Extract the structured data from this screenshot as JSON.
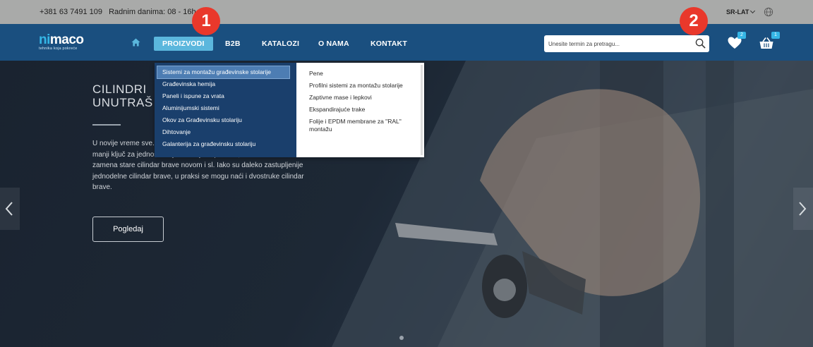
{
  "topbar": {
    "phone": "+381 63 7491 109",
    "hours": "Radnim danima: 08 - 16h",
    "language": "SR-LAT"
  },
  "logo": {
    "word_part1": "ni",
    "word_part2": "maco",
    "tagline": "tehnika koja pokreće"
  },
  "nav": {
    "items": [
      {
        "label": "PROIZVODI",
        "active": true
      },
      {
        "label": "B2B"
      },
      {
        "label": "KATALOZI"
      },
      {
        "label": "O NAMA"
      },
      {
        "label": "KONTAKT"
      }
    ]
  },
  "search": {
    "placeholder": "Unesite termin za pretragu..."
  },
  "wishlist": {
    "count": "2"
  },
  "cart": {
    "count": "1"
  },
  "dropdown": {
    "left_items": [
      "Sistemi za montažu građevinske stolarije",
      "Građevinska hemija",
      "Paneli i ispune za vrata",
      "Aluminijumski sistemi",
      "Okov za Građevinsku stolariju",
      "Dihtovanje",
      "Galanterija za građevinsku stolariju"
    ],
    "right_items": [
      "Pene",
      "Profilni sistemi za montažu stolarije",
      "Zaptivne mase i lepkovi",
      "Ekspandirajuće trake",
      "Folije i EPDM membrane za \"RAL\" montažu"
    ]
  },
  "hero": {
    "title_line1": "CILINDRI",
    "title_line2": "UNUTRAŠ",
    "description": "U novije vreme sve... praktičnije za upot... koji se ne može kopirati, manji ključ za jednostavnije nošenje i upotrebu, lakša demontaža i zamena stare cilindar brave novom i sl. Iako su daleko zastupljenije jednodelne cilindar brave, u praksi se mogu naći i dvostruke cilindar brave.",
    "cta_label": "Pogledaj"
  },
  "markers": {
    "one": "1",
    "two": "2"
  },
  "colors": {
    "navbar": "#1a4f7f",
    "accent": "#35b6e6",
    "active_nav": "#5bb7dd",
    "dropdown_left": "#1a3f6c",
    "marker": "#e9382b"
  }
}
